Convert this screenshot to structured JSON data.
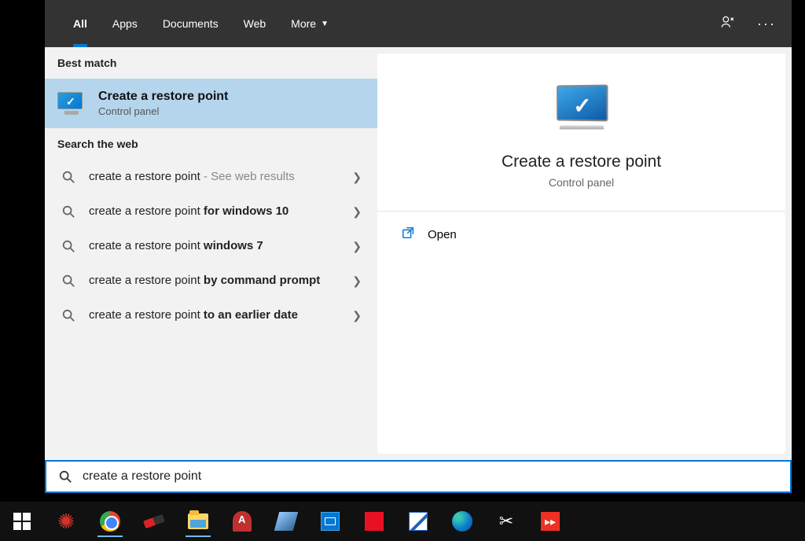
{
  "tabs": {
    "all": "All",
    "apps": "Apps",
    "documents": "Documents",
    "web": "Web",
    "more": "More"
  },
  "sections": {
    "best_match": "Best match",
    "search_web": "Search the web"
  },
  "best_match": {
    "title": "Create a restore point",
    "subtitle": "Control panel"
  },
  "web_results": [
    {
      "prefix": "create a restore point",
      "bold": "",
      "suffix": " - See web results"
    },
    {
      "prefix": "create a restore point ",
      "bold": "for windows 10",
      "suffix": ""
    },
    {
      "prefix": "create a restore point ",
      "bold": "windows 7",
      "suffix": ""
    },
    {
      "prefix": "create a restore point ",
      "bold": "by command prompt",
      "suffix": ""
    },
    {
      "prefix": "create a restore point ",
      "bold": "to an earlier date",
      "suffix": ""
    }
  ],
  "detail": {
    "title": "Create a restore point",
    "subtitle": "Control panel",
    "action_open": "Open"
  },
  "search_input": {
    "value": "create a restore point"
  },
  "taskbar": {
    "items": [
      "start",
      "huawei",
      "chrome",
      "usb",
      "explorer",
      "pdfa",
      "sticky",
      "bluesq",
      "redsq",
      "diagsq",
      "edge",
      "snip",
      "anydesk"
    ]
  }
}
